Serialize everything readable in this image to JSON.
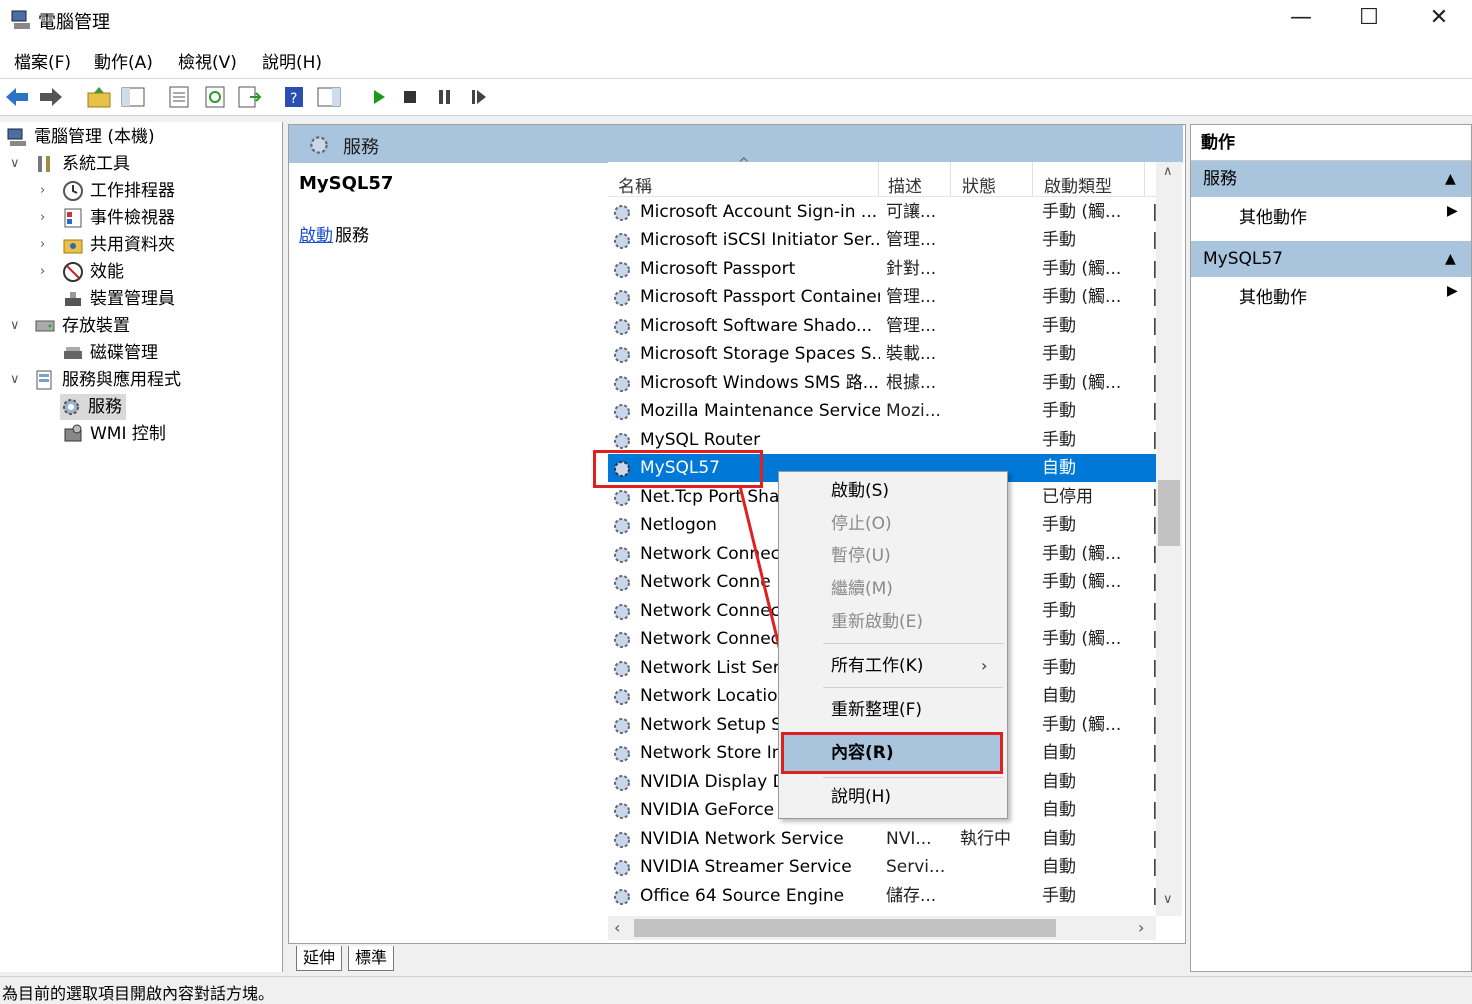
{
  "window": {
    "title": "電腦管理",
    "minimize": "—",
    "maximize": "☐",
    "close": "✕"
  },
  "menu": [
    "檔案(F)",
    "動作(A)",
    "檢視(V)",
    "說明(H)"
  ],
  "tree": {
    "root": "電腦管理 (本機)",
    "system_tools": "系統工具",
    "task_scheduler": "工作排程器",
    "event_viewer": "事件檢視器",
    "shared_folders": "共用資料夾",
    "performance": "效能",
    "device_manager": "裝置管理員",
    "storage": "存放裝置",
    "disk_management": "磁碟管理",
    "services_apps": "服務與應用程式",
    "services": "服務",
    "wmi": "WMI 控制"
  },
  "center": {
    "header": "服務",
    "selected_title": "MySQL57",
    "start_link": "啟動",
    "start_suffix": "服務",
    "columns": {
      "name": "名稱",
      "desc": "描述",
      "status": "狀態",
      "startup": "啟動類型"
    }
  },
  "services": [
    {
      "name": "Microsoft Account Sign-in ...",
      "desc": "可讓...",
      "status": "",
      "startup": "手動 (觸..."
    },
    {
      "name": "Microsoft iSCSI Initiator Ser...",
      "desc": "管理...",
      "status": "",
      "startup": "手動"
    },
    {
      "name": "Microsoft Passport",
      "desc": "針對...",
      "status": "",
      "startup": "手動 (觸..."
    },
    {
      "name": "Microsoft Passport Container",
      "desc": "管理...",
      "status": "",
      "startup": "手動 (觸..."
    },
    {
      "name": "Microsoft Software Shado...",
      "desc": "管理...",
      "status": "",
      "startup": "手動"
    },
    {
      "name": "Microsoft Storage Spaces S...",
      "desc": "裝載...",
      "status": "",
      "startup": "手動"
    },
    {
      "name": "Microsoft Windows SMS 路...",
      "desc": "根據...",
      "status": "",
      "startup": "手動 (觸..."
    },
    {
      "name": "Mozilla Maintenance Service",
      "desc": "Mozi...",
      "status": "",
      "startup": "手動"
    },
    {
      "name": "MySQL Router",
      "desc": "",
      "status": "",
      "startup": "手動"
    },
    {
      "name": "MySQL57",
      "desc": "",
      "status": "",
      "startup": "自動"
    },
    {
      "name": "Net.Tcp Port Sha",
      "desc": "",
      "status": "",
      "startup": "已停用"
    },
    {
      "name": "Netlogon",
      "desc": "",
      "status": "",
      "startup": "手動"
    },
    {
      "name": "Network Connec",
      "desc": "",
      "status": "",
      "startup": "手動 (觸..."
    },
    {
      "name": "Network Conne",
      "desc": "",
      "status": "",
      "startup": "手動 (觸..."
    },
    {
      "name": "Network Connec",
      "desc": "",
      "status": "",
      "startup": "手動"
    },
    {
      "name": "Network Connec",
      "desc": "",
      "status": "",
      "startup": "手動 (觸..."
    },
    {
      "name": "Network List Serv",
      "desc": "",
      "status": "",
      "startup": "手動"
    },
    {
      "name": "Network Location",
      "desc": "",
      "status": "",
      "startup": "自動"
    },
    {
      "name": "Network Setup S",
      "desc": "",
      "status": "",
      "startup": "手動 (觸..."
    },
    {
      "name": "Network Store In",
      "desc": "",
      "status": "",
      "startup": "自動"
    },
    {
      "name": "NVIDIA Display D",
      "desc": "",
      "status": "",
      "startup": "自動"
    },
    {
      "name": "NVIDIA GeForce",
      "desc": "",
      "status": "",
      "startup": "自動"
    },
    {
      "name": "NVIDIA Network Service",
      "desc": "NVI...",
      "status": "執行中",
      "startup": "自動"
    },
    {
      "name": "NVIDIA Streamer Service",
      "desc": "Servi...",
      "status": "",
      "startup": "自動"
    },
    {
      "name": "Office 64 Source Engine",
      "desc": "儲存...",
      "status": "",
      "startup": "手動"
    }
  ],
  "tabs": {
    "extended": "延伸",
    "standard": "標準"
  },
  "actions": {
    "header": "動作",
    "section1": "服務",
    "more1": "其他動作",
    "section2": "MySQL57",
    "more2": "其他動作"
  },
  "context_menu": {
    "start": "啟動(S)",
    "stop": "停止(O)",
    "pause": "暫停(U)",
    "resume": "繼續(M)",
    "restart": "重新啟動(E)",
    "all_tasks": "所有工作(K)",
    "refresh": "重新整理(F)",
    "properties": "內容(R)",
    "help": "說明(H)"
  },
  "status_bar": "為目前的選取項目開啟內容對話方塊。",
  "colors": {
    "selection": "#0078d7",
    "header_blue": "#a9c4dd",
    "highlight_red": "#e02020"
  }
}
